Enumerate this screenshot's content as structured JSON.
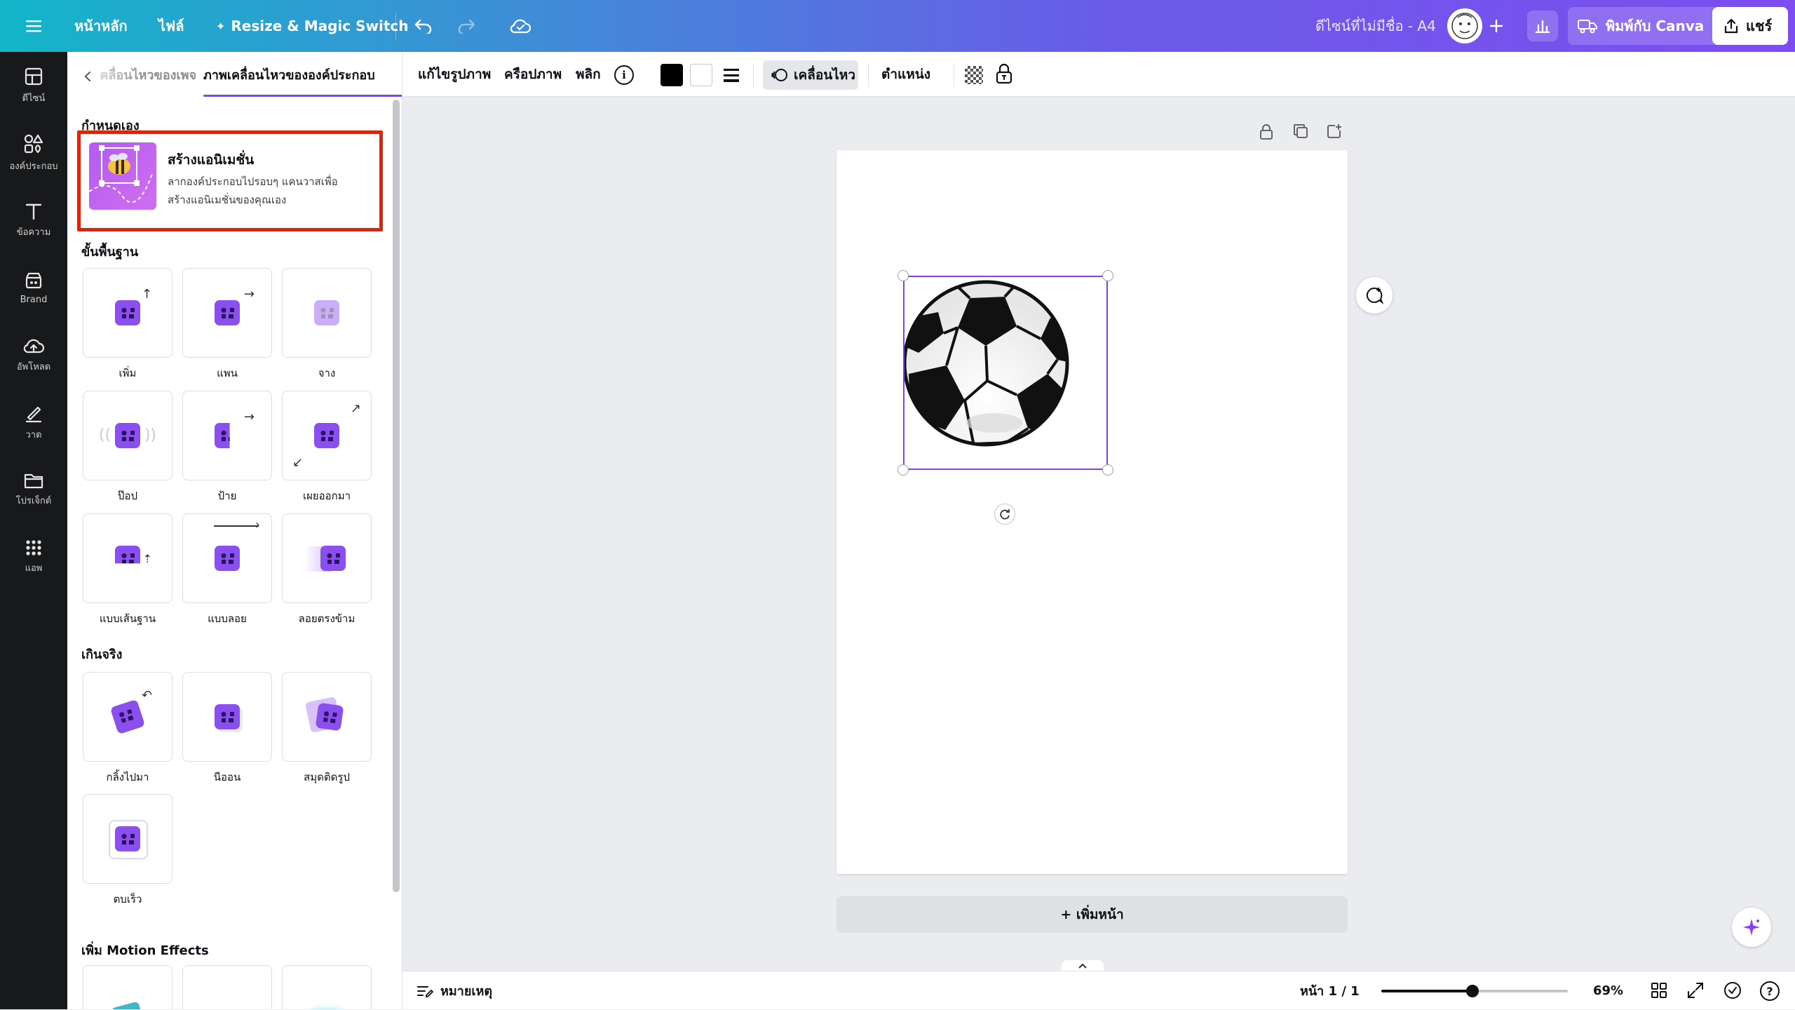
{
  "topbar": {
    "home": "หน้าหลัก",
    "file": "ไฟล์",
    "resize": "Resize & Magic Switch",
    "doc_title": "ดีไซน์ที่ไม่มีชื่อ - A4",
    "print": "พิมพ์กับ Canva",
    "share": "แชร์"
  },
  "rail": {
    "items": [
      {
        "label": "ดีไซน์",
        "icon": "layout-icon"
      },
      {
        "label": "องค์ประกอบ",
        "icon": "elements-icon"
      },
      {
        "label": "ข้อความ",
        "icon": "text-icon"
      },
      {
        "label": "Brand",
        "icon": "brand-icon"
      },
      {
        "label": "อัพโหลด",
        "icon": "upload-icon"
      },
      {
        "label": "วาด",
        "icon": "draw-icon"
      },
      {
        "label": "โปรเจ็กต์",
        "icon": "folder-icon"
      },
      {
        "label": "แอพ",
        "icon": "apps-icon"
      }
    ]
  },
  "panel": {
    "tab_page": "ภาพเคลื่อนไหวของเพจ",
    "tab_element": "ภาพเคลื่อนไหวขององค์ประกอบ",
    "custom_title": "กำหนดเอง",
    "create_title": "สร้างแอนิเมชั่น",
    "create_desc_1": "ลากองค์ประกอบไปรอบๆ แคนวาสเพื่อ",
    "create_desc_2": "สร้างแอนิเมชั่นของคุณเอง",
    "basic_title": "ขั้นพื้นฐาน",
    "basic": [
      "เพิ่ม",
      "แพน",
      "จาง",
      "ป๊อป",
      "ป้าย",
      "เผยออกมา",
      "แบบเส้นฐาน",
      "แบบลอย",
      "ลอยตรงข้าม"
    ],
    "exaggerate_title": "เกินจริง",
    "exaggerate": [
      "กลิ้งไปมา",
      "นีออน",
      "สมุดติดรูป",
      "ตบเร็ว"
    ],
    "motion_title": "เพิ่ม Motion Effects"
  },
  "ctx": {
    "edit_image": "แก้ไขรูปภาพ",
    "crop": "ครือปภาพ",
    "flip": "พลิก",
    "animate": "เคลื่อนไหว",
    "position": "ตำแหน่ง",
    "swatch_1": "#000000",
    "swatch_2": "#ffffff"
  },
  "canvas": {
    "add_page": "+ เพิ่มหน้า"
  },
  "bottom": {
    "notes": "หมายเหตุ",
    "page_indicator": "หน้า 1 / 1",
    "zoom": "69%",
    "zoom_level": 0.49
  },
  "colors": {
    "accent": "#8b3dff",
    "highlight": "#e0240b",
    "rail_bg": "#18191b"
  }
}
